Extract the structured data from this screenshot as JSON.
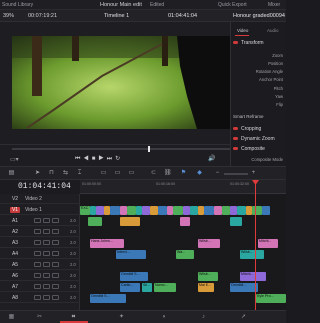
{
  "top_bar": {
    "left_label": "Sound Library",
    "project_title": "Honour Main edit",
    "status": "Edited",
    "quick_export": "Quick Export",
    "mixer": "Mixer"
  },
  "viewer_toolbar": {
    "zoom": "39%",
    "source_timecode": "00:07:19:21",
    "timeline_name": "Timeline 1",
    "record_timecode": "01:04:41:04",
    "clip_name": "Honour graded00094"
  },
  "inspector": {
    "tabs": [
      "Video",
      "Audio"
    ],
    "transform_label": "Transform",
    "transform_fields": [
      "Zoom",
      "Position",
      "Rotation Angle",
      "Anchor Point",
      "Pitch",
      "Yaw",
      "Flip"
    ],
    "smart_reframe": "Smart Reframe",
    "cropping": "Cropping",
    "dynamic_zoom": "Dynamic Zoom",
    "composite": "Composite",
    "composite_mode": "Composite Mode"
  },
  "timeline": {
    "timecode": "01:04:41:04",
    "ruler_labels": [
      "01:00:00:00",
      "01:00:16:00",
      "01:00:32:00"
    ],
    "tracks": [
      {
        "id": "V2",
        "name": "Video 2",
        "level": ""
      },
      {
        "id": "V1",
        "name": "Video 1",
        "level": ""
      },
      {
        "id": "A1",
        "name": "",
        "level": "2.0"
      },
      {
        "id": "A2",
        "name": "",
        "level": "2.0"
      },
      {
        "id": "A3",
        "name": "",
        "level": "2.0"
      },
      {
        "id": "A4",
        "name": "",
        "level": "2.0"
      },
      {
        "id": "A5",
        "name": "",
        "level": "2.0"
      },
      {
        "id": "A6",
        "name": "",
        "level": "2.0"
      },
      {
        "id": "A7",
        "name": "",
        "level": "2.0"
      },
      {
        "id": "A8",
        "name": "",
        "level": "2.0"
      }
    ],
    "clip_labels": {
      "v1_first": "EXC",
      "a3_first": "Hans Johns...",
      "a3_second": "Wilsb...",
      "a3_third": "Mitchl...",
      "a4_first": "Intervi...",
      "a4_second": "Wa...",
      "a4_third": "Wilsb...",
      "a6_first": "Omnibil S...",
      "a6_second": "Wilsb...",
      "a6_third": "Mitchl...",
      "a7_first": "Carlin...",
      "a7_second": "Sil...",
      "a7_third": "Nomo...",
      "a7_fourth": "Mal E...",
      "a7_fifth": "Omnibil...",
      "a8_first": "Omnibil S...",
      "a8_second": "Kyle Pro..."
    }
  },
  "colors": {
    "accent_red": "#d73a3a",
    "clip_blue": "#3a78b8",
    "clip_green": "#4fae5a",
    "clip_teal": "#2aa7a1",
    "clip_pink": "#d274b6",
    "clip_purple": "#8e6ad8",
    "clip_orange": "#d99a3a"
  },
  "bottom_bar": {
    "pages": [
      "media-icon",
      "cut-icon",
      "edit-icon",
      "fusion-icon",
      "color-icon",
      "fairlight-icon",
      "deliver-icon"
    ]
  }
}
